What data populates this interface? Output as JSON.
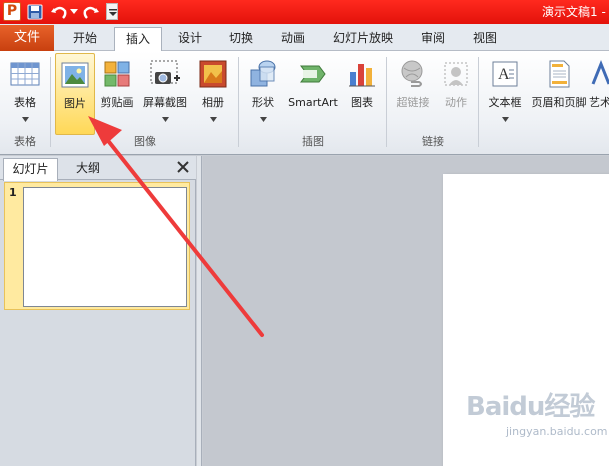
{
  "app": {
    "title": "演示文稿1 -",
    "logo_letter": "P"
  },
  "tabs": {
    "file": "文件",
    "items": [
      "开始",
      "插入",
      "设计",
      "切换",
      "动画",
      "幻灯片放映",
      "审阅",
      "视图"
    ],
    "active": "插入"
  },
  "ribbon": {
    "buttons": {
      "table": "表格",
      "picture": "图片",
      "clipart": "剪贴画",
      "screenshot": "屏幕截图",
      "album": "相册",
      "shapes": "形状",
      "smartart": "SmartArt",
      "chart": "图表",
      "hyperlink": "超链接",
      "action": "动作",
      "textbox": "文本框",
      "header_footer": "页眉和页脚",
      "art": "艺术"
    },
    "groups": {
      "tables": "表格",
      "images": "图像",
      "illustrations": "插图",
      "links": "链接"
    }
  },
  "left_pane": {
    "tab_slides": "幻灯片",
    "tab_outline": "大纲",
    "slide_number": "1"
  },
  "watermark": {
    "brand": "Baidu经验",
    "url": "jingyan.baidu.com"
  },
  "colors": {
    "titlebar": "#e3120b",
    "file_tab": "#d04a14",
    "highlight": "#ffe38a",
    "annotation_arrow": "#ee3b3b"
  }
}
